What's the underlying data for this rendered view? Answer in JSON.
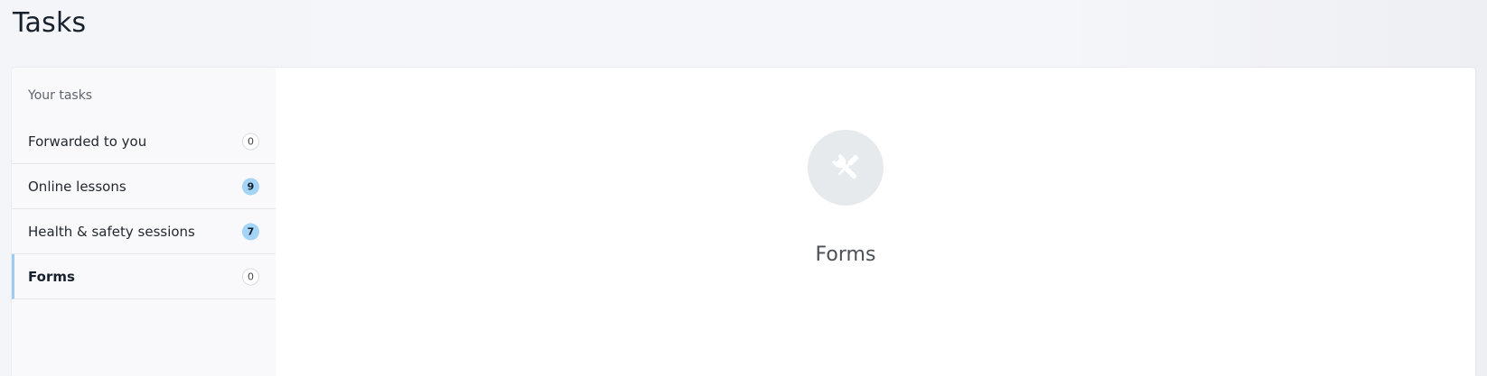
{
  "page": {
    "title": "Tasks"
  },
  "sidebar": {
    "heading": "Your tasks",
    "items": [
      {
        "label": "Forwarded to you",
        "count": "0",
        "active": false
      },
      {
        "label": "Online lessons",
        "count": "9",
        "active": false
      },
      {
        "label": "Health & safety sessions",
        "count": "7",
        "active": false
      },
      {
        "label": "Forms",
        "count": "0",
        "active": true
      }
    ]
  },
  "main": {
    "icon": "tools-icon",
    "title": "Forms"
  },
  "colors": {
    "accent": "#9ccdf0",
    "badge_count_bg": "#a4d4f6",
    "icon_circle_bg": "#e7eaed"
  }
}
